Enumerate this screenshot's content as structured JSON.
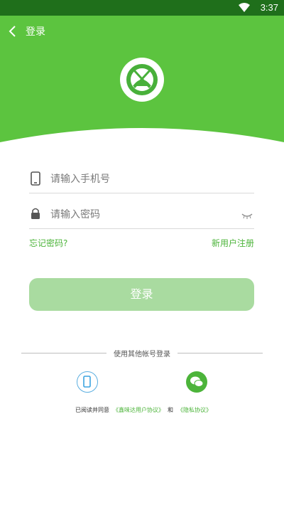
{
  "status_bar": {
    "time": "3:37"
  },
  "nav": {
    "title": "登录"
  },
  "login_form": {
    "phone_placeholder": "请输入手机号",
    "password_placeholder": "请输入密码",
    "forgot_password": "忘记密码?",
    "register": "新用户注册",
    "login_button": "登录"
  },
  "other_login": {
    "title": "使用其他帐号登录"
  },
  "agreement": {
    "prefix": "已阅读并同意",
    "user_agreement": "《鑫味达用户协议》",
    "and": "和",
    "privacy": "《隐私协议》"
  },
  "colors": {
    "brand_green": "#5cc43f",
    "link_green": "#4cb43a",
    "button_disabled": "#a9dba0"
  }
}
